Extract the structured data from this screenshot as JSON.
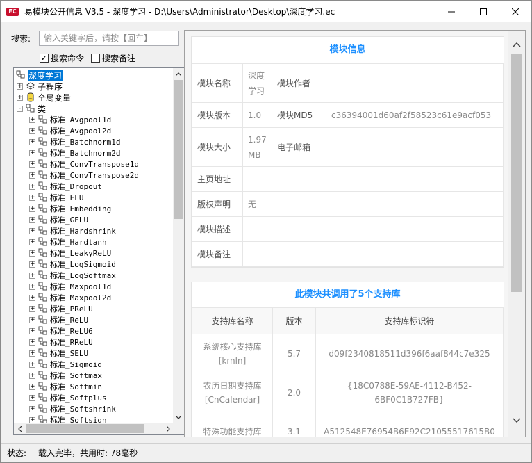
{
  "window": {
    "title": "易模块公开信息 V3.5 - 深度学习 - D:\\Users\\Administrator\\Desktop\\深度学习.ec",
    "app_icon_text": "EC",
    "buttons": [
      "minimize-icon",
      "maximize-icon",
      "close-icon"
    ]
  },
  "search": {
    "label": "搜索:",
    "placeholder": "输入关键字后，请按【回车】",
    "value": ""
  },
  "filters": {
    "search_commands": {
      "label": "搜索命令",
      "checked": true,
      "mark": "✓"
    },
    "search_notes": {
      "label": "搜索备注",
      "checked": false
    }
  },
  "tree": {
    "root": "深度学习",
    "groups": [
      {
        "label": "子程序",
        "icon": "subroutine-icon",
        "expander": "+"
      },
      {
        "label": "全局变量",
        "icon": "global-variable-icon",
        "expander": "+"
      },
      {
        "label": "类",
        "icon": "class-icon",
        "expander": "-"
      }
    ],
    "expander_plus": "+",
    "classes": [
      "标准_Avgpool1d",
      "标准_Avgpool2d",
      "标准_Batchnorm1d",
      "标准_Batchnorm2d",
      "标准_ConvTranspose1d",
      "标准_ConvTranspose2d",
      "标准_Dropout",
      "标准_ELU",
      "标准_Embedding",
      "标准_GELU",
      "标准_Hardshrink",
      "标准_Hardtanh",
      "标准_LeakyReLU",
      "标准_LogSigmoid",
      "标准_LogSoftmax",
      "标准_Maxpool1d",
      "标准_Maxpool2d",
      "标准_PReLU",
      "标准_ReLU",
      "标准_ReLU6",
      "标准_RReLU",
      "标准_SELU",
      "标准_Sigmoid",
      "标准_Softmax",
      "标准_Softmin",
      "标准_Softplus",
      "标准_Softshrink",
      "标准_Softsign"
    ]
  },
  "module_info": {
    "title": "模块信息",
    "name_label": "模块名称",
    "name_value": "深度学习",
    "author_label": "模块作者",
    "author_value": "",
    "version_label": "模块版本",
    "version_value": "1.0",
    "md5_label": "模块MD5",
    "md5_value": "c36394001d60af2f58523c61e9acf053",
    "size_label": "模块大小",
    "size_value": "1.97 MB",
    "email_label": "电子邮箱",
    "email_value": "",
    "homepage_label": "主页地址",
    "homepage_value": "",
    "copyright_label": "版权声明",
    "copyright_value": "无",
    "desc_label": "模块描述",
    "desc_value": "",
    "note_label": "模块备注",
    "note_value": ""
  },
  "libraries": {
    "title": "此模块共调用了5个支持库",
    "headers": [
      "支持库名称",
      "版本",
      "支持库标识符"
    ],
    "rows": [
      {
        "name": "系统核心支持库[krnln]",
        "version": "5.7",
        "id": "d09f2340818511d396f6aaf844c7e325"
      },
      {
        "name": "农历日期支持库[CnCalendar]",
        "version": "2.0",
        "id": "{18C0788E-59AE-4112-B452-6BF0C1B727FB}"
      },
      {
        "name": "特殊功能支持库",
        "version": "3.1",
        "id": "A512548E76954B6E92C21055517615B0"
      }
    ]
  },
  "status": {
    "label": "状态:",
    "text": "载入完毕，共用时: 78毫秒"
  }
}
